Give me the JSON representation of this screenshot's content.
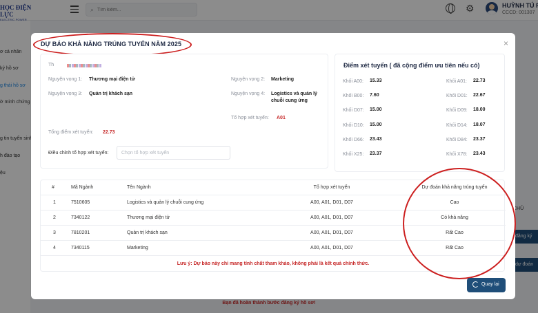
{
  "app": {
    "logo_line1": "HỌC ĐIỆN LỰC",
    "logo_line2": "ELECTRIC POWER UNIVERSITY",
    "search_placeholder": "Tìm kiếm...",
    "user_name": "HUỲNH TÚ F",
    "user_id": "CCCD: 001307"
  },
  "sidebar": {
    "items": [
      "ơ cá nhân",
      "ký hồ sơ",
      "g thái hồ sơ",
      "ờ minh chứng",
      "g tin tuyển sinh",
      "h đào tạo",
      "ệu"
    ]
  },
  "background": {
    "right_label": "CHỦ",
    "btn1": "đăng ký",
    "btn2": "dự đoán",
    "footer": "Bạn đã hoàn thành bước đăng ký hồ sơ!"
  },
  "modal": {
    "title": "DỰ BÁO KHẢ NĂNG TRÚNG TUYỂN NĂM 2025",
    "greeting": "Th",
    "wishes": [
      {
        "label": "Nguyện vọng 1:",
        "value": "Thương mại điện tử"
      },
      {
        "label": "Nguyện vọng 2:",
        "value": "Marketing"
      },
      {
        "label": "Nguyện vọng 3:",
        "value": "Quản trị khách sạn"
      },
      {
        "label": "Nguyện vọng 4:",
        "value": "Logistics và quản lý chuỗi cung ứng"
      }
    ],
    "combo_label": "Tổ hợp xét tuyển:",
    "combo_value": "A01",
    "total_label": "Tổng điểm xét tuyển:",
    "total_value": "22.73",
    "adjust_label": "Điều chỉnh tổ hợp xét tuyển:",
    "adjust_placeholder": "Chọn tổ hợp xét tuyển",
    "scores_title": "Điểm xét tuyển ( đã cộng điểm ưu tiên nếu có)",
    "scores": [
      {
        "label": "Khối A00:",
        "value": "15.33"
      },
      {
        "label": "Khối A01:",
        "value": "22.73"
      },
      {
        "label": "Khối B00:",
        "value": "7.60"
      },
      {
        "label": "Khối D01:",
        "value": "22.67"
      },
      {
        "label": "Khối D07:",
        "value": "15.00"
      },
      {
        "label": "Khối D09:",
        "value": "18.00"
      },
      {
        "label": "Khối D10:",
        "value": "15.00"
      },
      {
        "label": "Khối D14:",
        "value": "18.07"
      },
      {
        "label": "Khối D66:",
        "value": "23.43"
      },
      {
        "label": "Khối D84:",
        "value": "23.37"
      },
      {
        "label": "Khối X25:",
        "value": "23.37"
      },
      {
        "label": "Khối X78:",
        "value": "23.43"
      }
    ],
    "table": {
      "headers": [
        "#",
        "Mã Ngành",
        "Tên Ngành",
        "Tổ hợp xét tuyển",
        "Dự đoán khả năng trúng tuyển"
      ],
      "rows": [
        [
          "1",
          "7510605",
          "Logistics và quản lý chuỗi cung ứng",
          "A00, A01, D01, D07",
          "Cao"
        ],
        [
          "2",
          "7340122",
          "Thương mại điện tử",
          "A00, A01, D01, D07",
          "Có khả năng"
        ],
        [
          "3",
          "7810201",
          "Quản trị khách sạn",
          "A00, A01, D01, D07",
          "Rất Cao"
        ],
        [
          "4",
          "7340115",
          "Marketing",
          "A00, A01, D01, D07",
          "Rất Cao"
        ]
      ]
    },
    "note": "Lưu ý: Dự báo này chỉ mang tính chất tham khảo, không phải là kết quả chính thức.",
    "back_button": "Quay lại",
    "close_symbol": "×"
  }
}
